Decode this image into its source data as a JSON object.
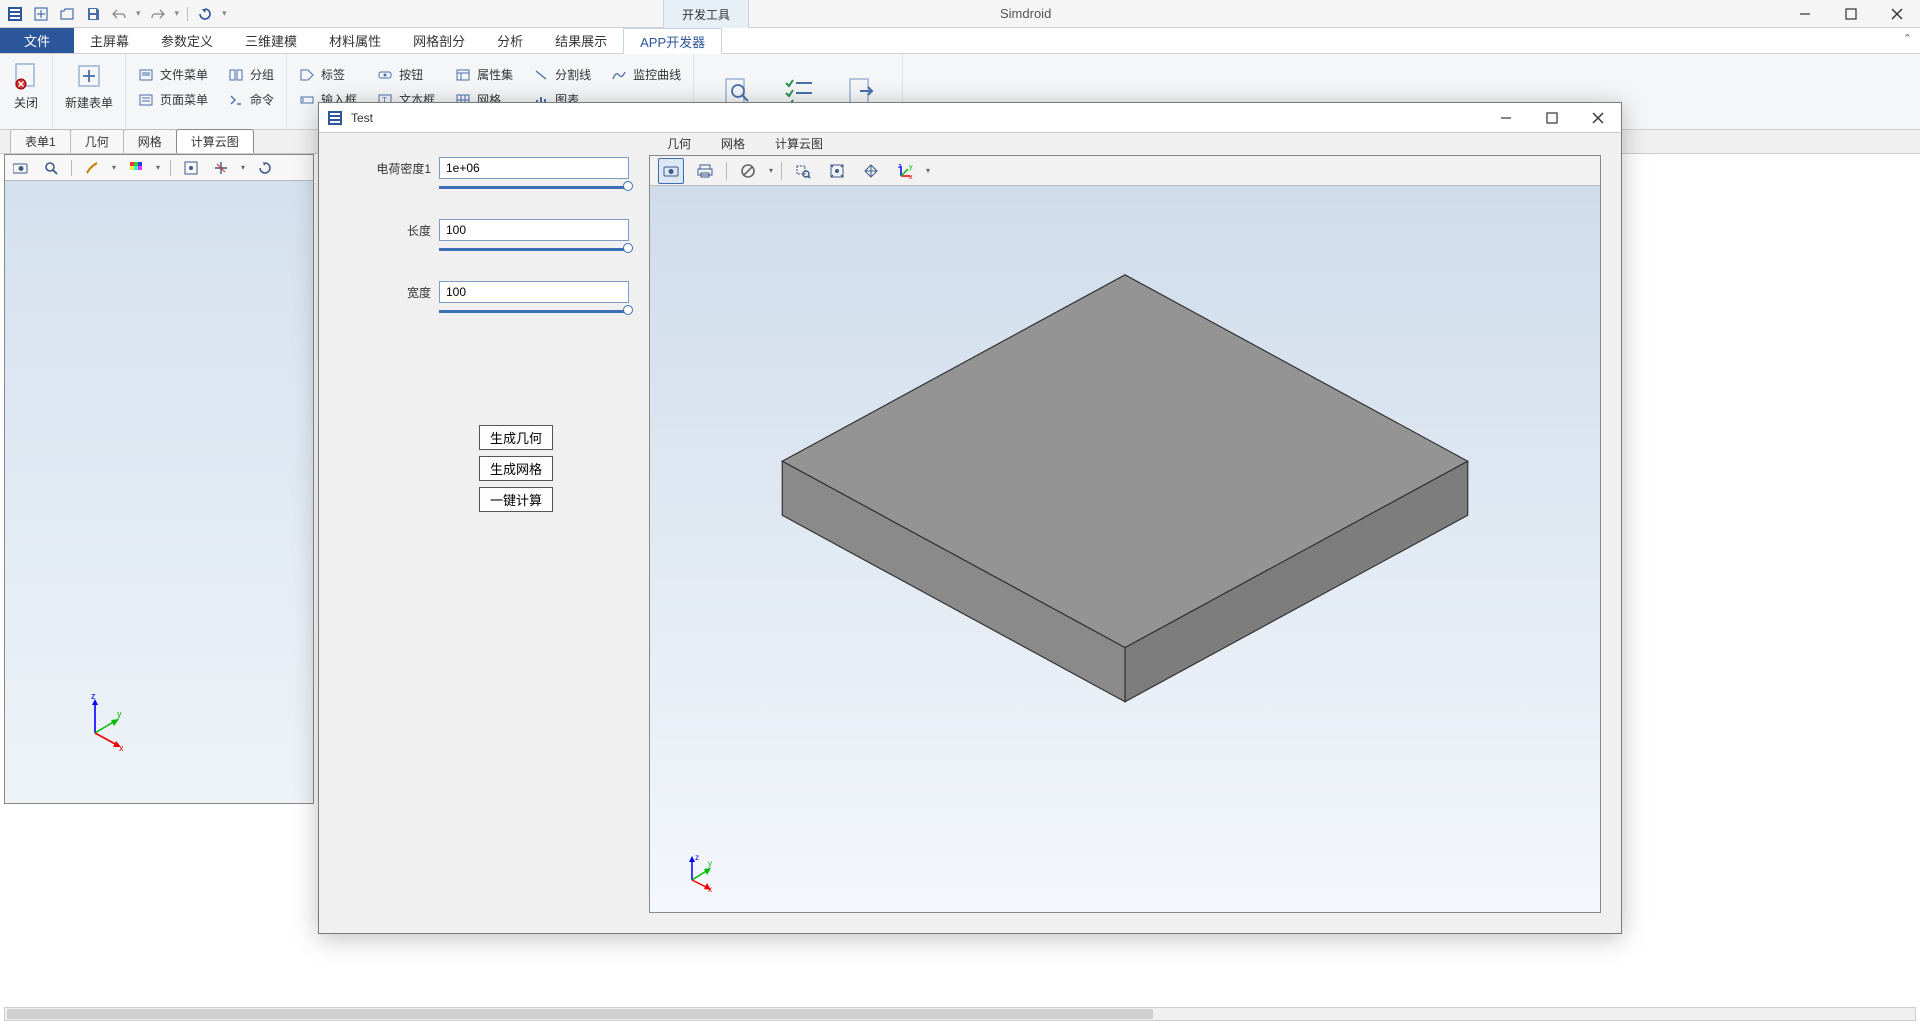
{
  "app": {
    "title": "Simdroid",
    "dev_tools_tab": "开发工具"
  },
  "ribbon": {
    "tabs": [
      "主屏幕",
      "参数定义",
      "三维建模",
      "材料属性",
      "网格剖分",
      "分析",
      "结果展示"
    ],
    "file_tab": "文件",
    "active_tab": "APP开发器",
    "close": "关闭",
    "new_form": "新建表单",
    "small": {
      "file_menu": "文件菜单",
      "page_menu": "页面菜单",
      "group": "分组",
      "command": "命令",
      "label": "标签",
      "input": "输入框",
      "button": "按钮",
      "textbox": "文本框",
      "propset": "属性集",
      "mesh": "网格",
      "split": "分割线",
      "chart": "图表",
      "monitor": "监控曲线"
    }
  },
  "doc_tabs": [
    "表单1",
    "几何",
    "网格",
    "计算云图"
  ],
  "doc_active_index": 3,
  "dialog": {
    "title": "Test",
    "params": [
      {
        "label": "电荷密度1",
        "value": "1e+06"
      },
      {
        "label": "长度",
        "value": "100"
      },
      {
        "label": "宽度",
        "value": "100"
      }
    ],
    "buttons": [
      "生成几何",
      "生成网格",
      "一键计算"
    ],
    "viewer_tabs": [
      "几何",
      "网格",
      "计算云图"
    ]
  }
}
